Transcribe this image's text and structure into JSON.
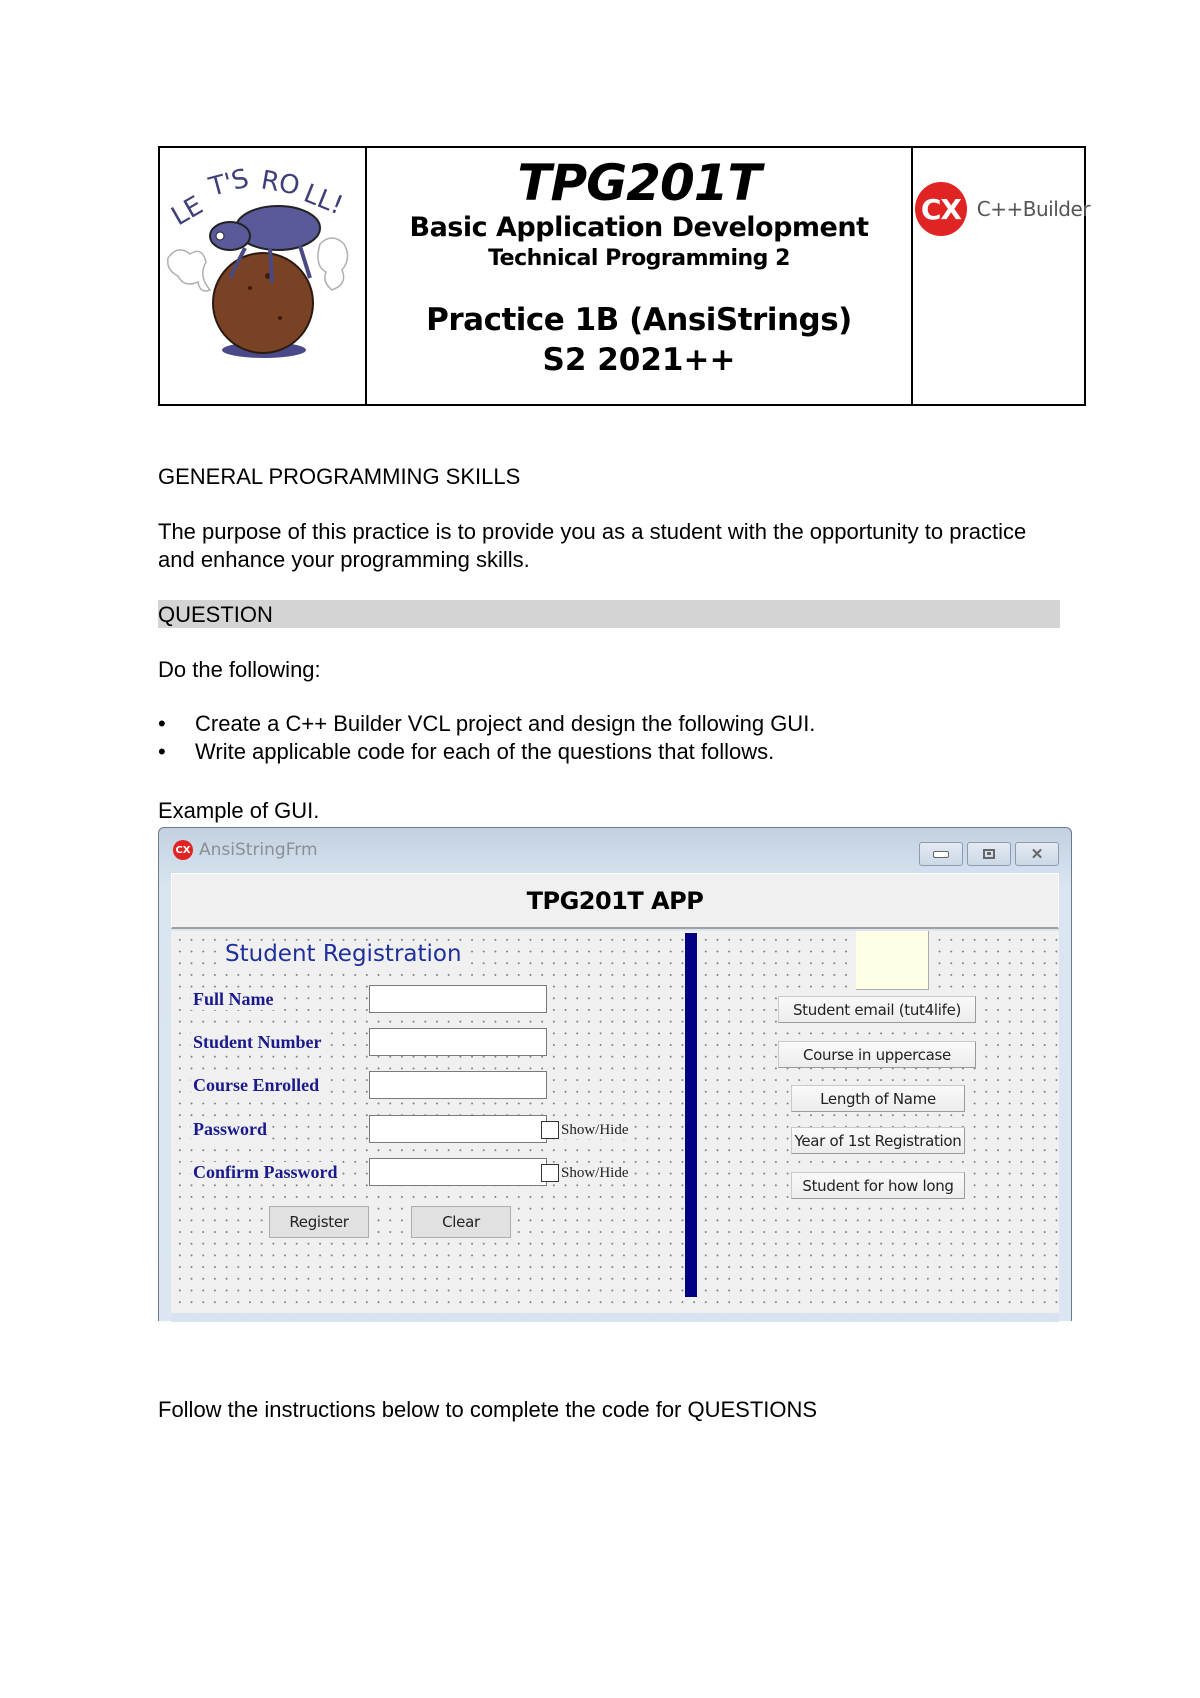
{
  "header": {
    "logo_left_alt": "Let's Roll! dung beetle illustration",
    "course_code": "TPG201T",
    "subject": "Basic Application Development",
    "subtitle": "Technical Programming 2",
    "practice": "Practice 1B (AnsiStrings)",
    "semester": "S2 2021++",
    "brand_badge": "CX",
    "brand_name": "C++Builder"
  },
  "body": {
    "section_heading": "GENERAL PROGRAMMING SKILLS",
    "purpose": "The purpose of this practice is to provide you as a student with the opportunity to practice and  enhance your programming skills.",
    "question_heading": "QUESTION",
    "do_following": "Do the following:",
    "bullet_char": "•",
    "bullets": [
      "Create a C++ Builder VCL project and design the following GUI.",
      "Write applicable code for each of the questions that follows."
    ],
    "example_label": "Example of GUI.",
    "follow_instructions": "Follow the instructions below to complete the code for QUESTIONS"
  },
  "gui": {
    "window_icon": "CX",
    "window_title": "AnsiStringFrm",
    "controls": {
      "close_glyph": "✕"
    },
    "app_title": "TPG201T APP",
    "registration_title": "Student Registration",
    "fields": [
      {
        "label": "Full Name",
        "value": "",
        "show_hide": null
      },
      {
        "label": "Student Number",
        "value": "",
        "show_hide": null
      },
      {
        "label": "Course Enrolled",
        "value": "",
        "show_hide": null
      },
      {
        "label": "Password",
        "value": "",
        "show_hide": "Show/Hide"
      },
      {
        "label": "Confirm Password",
        "value": "",
        "show_hide": "Show/Hide"
      }
    ],
    "register_label": "Register",
    "clear_label": "Clear",
    "right_buttons": [
      "Student email (tut4life)",
      "Course in uppercase",
      "Length of Name",
      "Year of 1st Registration",
      "Student for how long"
    ],
    "colors": {
      "divider": "#000080",
      "label_text": "#1a1a8c",
      "output_box": "#ffffe6",
      "brand_red": "#e02424"
    }
  }
}
